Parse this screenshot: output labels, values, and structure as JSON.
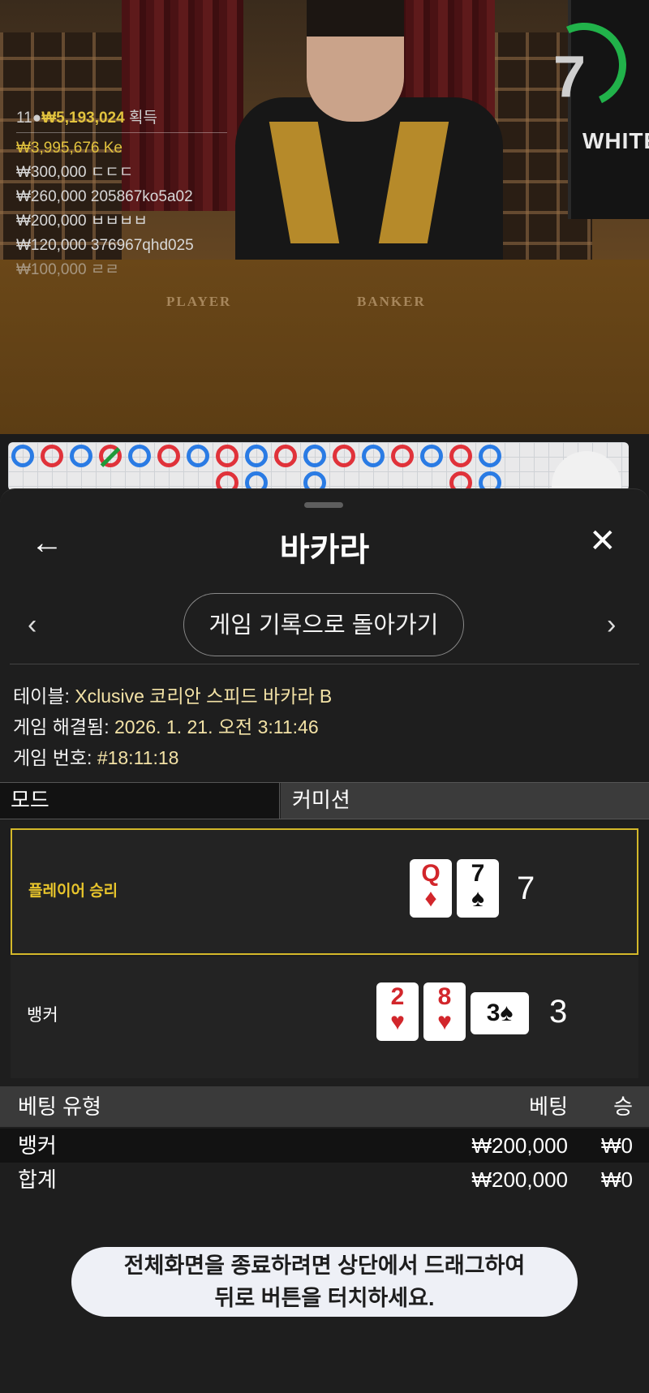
{
  "video": {
    "player_label": "PLAYER",
    "banker_label": "BANKER",
    "timer": "7",
    "brand": "WHITE",
    "winners": {
      "count": "11",
      "total": "₩5,193,024",
      "suffix": "획득",
      "rows": [
        {
          "amount": "₩3,995,676",
          "name": "Ke"
        },
        {
          "amount": "₩300,000",
          "name": "ㄷㄷㄷ"
        },
        {
          "amount": "₩260,000",
          "name": "205867ko5a02"
        },
        {
          "amount": "₩200,000",
          "name": "ㅂㅂㅂㅂ"
        },
        {
          "amount": "₩120,000",
          "name": "376967qhd025"
        },
        {
          "amount": "₩100,000",
          "name": "ㄹㄹ"
        }
      ]
    }
  },
  "panel": {
    "title": "바카라",
    "back_icon": "arrow-left-icon",
    "close_icon": "close-icon",
    "back_to_history": "게임 기록으로 돌아가기",
    "table_label": "테이블:",
    "table_value": "Xclusive 코리안 스피드 바카라 B",
    "resolved_label": "게임 해결됨:",
    "resolved_value": "2026. 1. 21. 오전 3:11:46",
    "round_label": "게임 번호:",
    "round_value": "#18:11:18",
    "tabs": [
      "모드",
      "커미션"
    ],
    "player": {
      "label": "플레이어 승리",
      "cards": [
        {
          "rank": "Q",
          "suit": "♦"
        },
        {
          "rank": "7",
          "suit": "♠"
        }
      ],
      "score": "7"
    },
    "banker": {
      "label": "뱅커",
      "cards": [
        {
          "rank": "2",
          "suit": "♥"
        },
        {
          "rank": "8",
          "suit": "♥"
        },
        {
          "rank": "3",
          "suit": "♠"
        }
      ],
      "score": "3"
    },
    "bets": {
      "headers": [
        "베팅 유형",
        "베팅",
        "승"
      ],
      "rows": [
        {
          "type": "뱅커",
          "bet": "₩200,000",
          "win": "₩0"
        },
        {
          "type": "합계",
          "bet": "₩200,000",
          "win": "₩0"
        }
      ]
    },
    "toast": [
      "전체화면을 종료하려면 상단에서 드래그하여",
      "뒤로 버튼을 터치하세요."
    ]
  },
  "colors": {
    "accent_gold": "#d4b82a",
    "player_blue": "#2a7be4",
    "banker_red": "#e0323a",
    "tie_green": "#1f9a3a",
    "timer_green": "#21b24a"
  }
}
